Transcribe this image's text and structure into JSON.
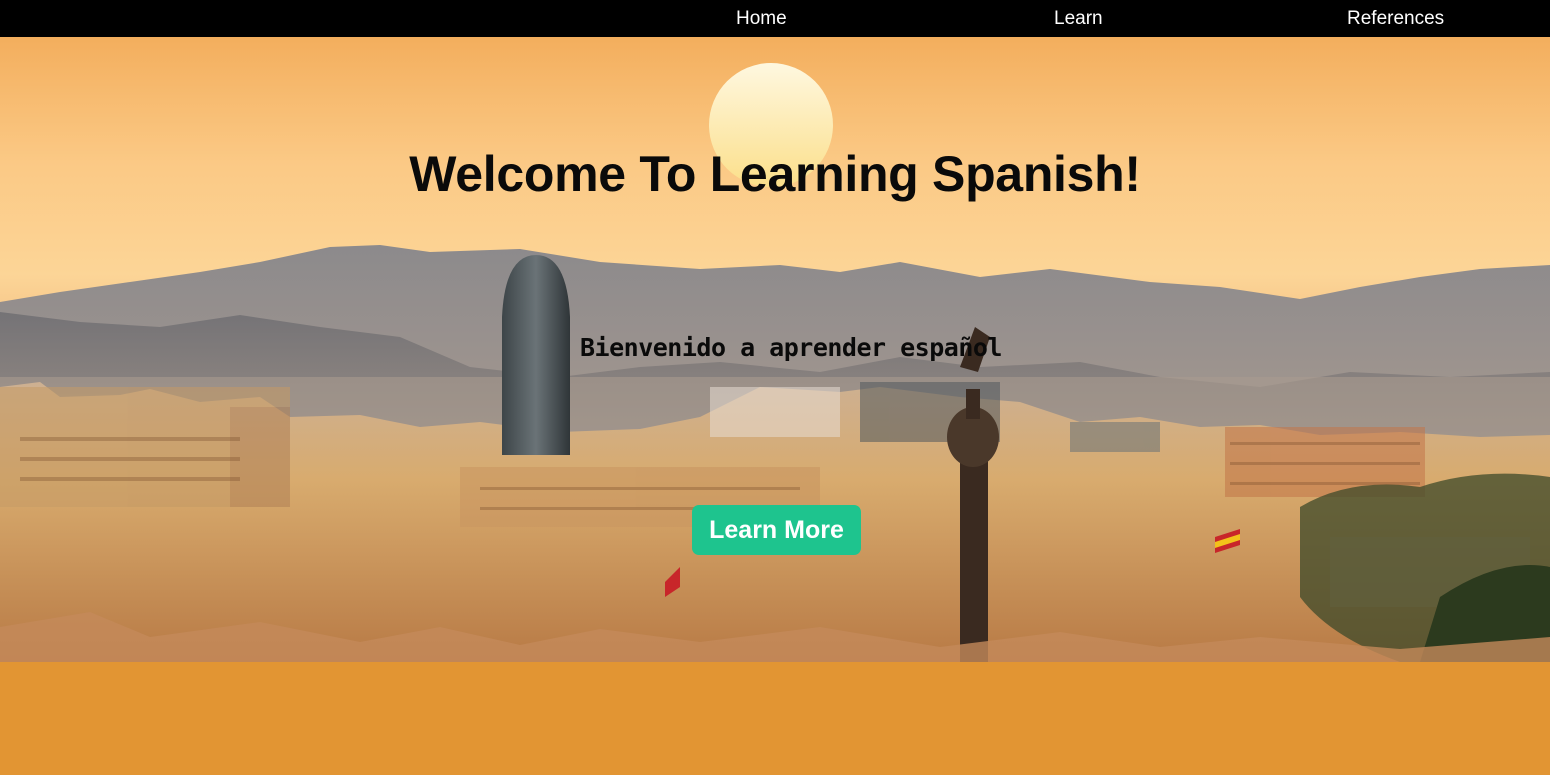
{
  "nav": {
    "links": [
      {
        "label": "Home"
      },
      {
        "label": "Learn"
      },
      {
        "label": "References"
      }
    ]
  },
  "hero": {
    "title": "Welcome To Learning Spanish!",
    "subtitle": "Bienvenido a aprender español",
    "cta_label": "Learn More",
    "background_image": "barcelona-skyline-sunset"
  },
  "colors": {
    "nav_bg": "#000000",
    "cta_bg": "#1ec48e",
    "band_bg": "#e29533"
  }
}
